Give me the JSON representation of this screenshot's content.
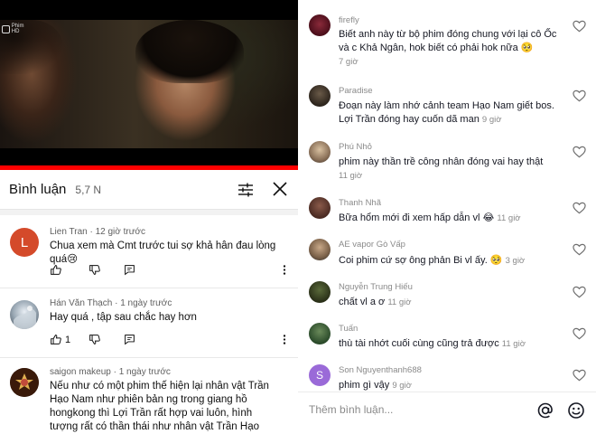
{
  "youtube": {
    "video": {
      "channel_logo_text": "Phim HD",
      "progress_fraction": 1.0,
      "colors": {
        "progress": "#ff0000"
      }
    },
    "comments_header": {
      "title": "Bình luận",
      "count": "5,7 N",
      "icons": [
        "filter-icon",
        "close-icon"
      ]
    },
    "comments": [
      {
        "user": "Lien Tran",
        "time": "12 giờ trước",
        "text": "Chua xem mà Cmt trước tui sợ khả hân đau lòng quá😢",
        "likes": "",
        "avatar_letter": "L",
        "avatar_color": "#d44a2a"
      },
      {
        "user": "Hán Văn Thạch",
        "time": "1 ngày trước",
        "text": "Hay quá , tập sau chắc hay hơn",
        "likes": "1"
      },
      {
        "user": "saigon makeup",
        "time": "1 ngày trước",
        "text": "Nếu như có một phim thế hiện lại nhân vật Trần Hạo Nam như phiên bản ng trong giang hồ hongkong thì Lợi Trần rất hợp vai luôn, hình tượng rất có thần thái như nhân vật Trần Hạo Nam 🖤",
        "likes": ""
      }
    ]
  },
  "tiktok": {
    "comments": [
      {
        "user": "firefly",
        "text": "Biết anh này từ bộ phim đóng chung với lại cô Ốc và c Khả Ngân, hok biết có phải hok nữa 🥺",
        "time": "7 giờ"
      },
      {
        "user": "Paradise",
        "text": "Đoạn này làm nhớ cảnh team Hạo Nam giết bos. Lợi Trần đóng hay cuốn dã man",
        "time": "9 giờ"
      },
      {
        "user": "Phú Nhỏ",
        "text": "phim này thần trề công nhân đóng vai hay thật",
        "time": "11 giờ"
      },
      {
        "user": "Thanh Nhã",
        "text": "Bữa hổm mới đi xem hấp dẫn vl 😂",
        "time": "11 giờ"
      },
      {
        "user": "AE vapor Gò Vấp",
        "text": "Coi phim cứ sợ ông phản Bi vl ấy. 🥺",
        "time": "3 giờ"
      },
      {
        "user": "Nguyễn Trung Hiếu",
        "text": "chất vl a ơ",
        "time": "11 giờ"
      },
      {
        "user": "Tuấn",
        "text": "thù tài nhớt cuối cùng cũng trả được",
        "time": "11 giờ"
      },
      {
        "user": "Son Nguyenthanh688",
        "text": "phim gì vậy",
        "time": "9 giờ",
        "avatar_letter": "S",
        "avatar_color": "#9a6ad8"
      }
    ],
    "input": {
      "placeholder": "Thêm bình luận...",
      "icons": [
        "at-icon",
        "emoji-icon"
      ]
    }
  }
}
